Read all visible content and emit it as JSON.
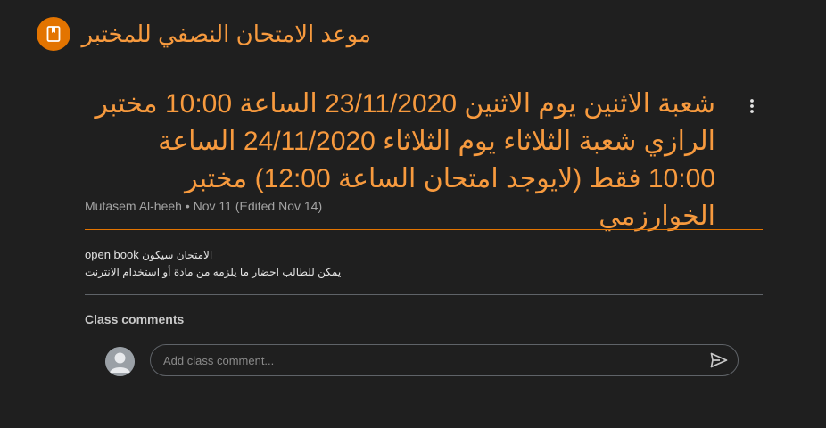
{
  "header": {
    "class_title": "موعد الامتحان النصفي للمختبر",
    "class_icon": "assignment-book-icon",
    "accent_color": "#e37400",
    "title_color": "#f79a3e"
  },
  "post": {
    "title": "شعبة الاثنين يوم الاثنين 23/11/2020 الساعة 10:00 مختبر الرازي شعبة الثلاثاء يوم الثلاثاء 24/11/2020 الساعة 10:00 فقط (لايوجد امتحان الساعة 12:00) مختبر الخوارزمي",
    "more_icon": "more-vert-icon",
    "author": "Mutasem Al-heeh",
    "separator": "•",
    "date": "Nov 11 (Edited Nov 14)",
    "body_line1_en": "open book",
    "body_line1_ar": "الامتحان سيكون",
    "body_line2": "يمكن للطالب احضار ما يلزمه من مادة أو استخدام الانترنت"
  },
  "comments": {
    "heading": "Class comments",
    "placeholder": "Add class comment...",
    "avatar_icon": "default-avatar-icon",
    "send_icon": "send-icon"
  }
}
